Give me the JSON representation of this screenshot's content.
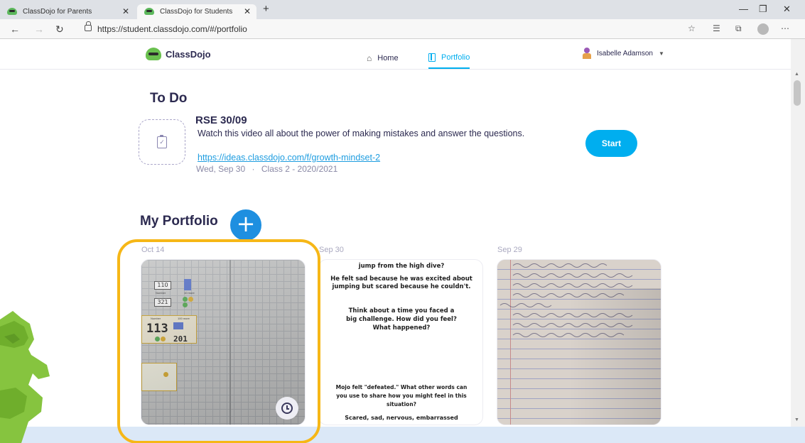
{
  "browser": {
    "tabs": [
      {
        "title": "ClassDojo for Parents",
        "active": false
      },
      {
        "title": "ClassDojo for Students",
        "active": true
      }
    ],
    "new_tab_symbol": "+",
    "url": "https://student.classdojo.com/#/portfolio",
    "nav_icons": [
      "back-arrow-icon",
      "forward-arrow-icon",
      "refresh-icon",
      "lock-icon"
    ],
    "toolbar_icons": [
      "favorite-star-icon",
      "favorites-list-icon",
      "collections-icon",
      "profile-icon",
      "more-icon"
    ],
    "window_controls": [
      "minimize-icon",
      "maximize-icon",
      "close-icon"
    ]
  },
  "header": {
    "brand": "ClassDojo",
    "nav": [
      {
        "label": "Home",
        "icon": "house-icon",
        "active": false
      },
      {
        "label": "Portfolio",
        "icon": "portfolio-icon",
        "active": true
      }
    ],
    "user_name": "Isabelle Adamson",
    "accent_color": "#00aeef"
  },
  "todo": {
    "heading": "To Do",
    "item": {
      "title": "RSE 30/09",
      "description": "Watch this video all about the power of making mistakes and answer the questions.",
      "link": "https://ideas.classdojo.com/f/growth-mindset-2",
      "date": "Wed, Sep 30",
      "separator": "·",
      "class_name": "Class 2 - 2020/2021",
      "start_label": "Start"
    }
  },
  "portfolio": {
    "heading": "My Portfolio",
    "add_symbol": "+",
    "posts": [
      {
        "date": "Oct 14",
        "highlight_color": "#f6b717",
        "worksheet": {
          "numbers": [
            "110",
            "321",
            "113",
            "201"
          ],
          "labels": [
            "Number",
            "10 more",
            "Number",
            "100 more"
          ]
        }
      },
      {
        "date": "Sep 30",
        "lines": [
          "jump from the high dive?",
          "He felt sad because he was excited about jumping but scared because he couldn't.",
          "Think about a time you faced a big challenge. How did you feel? What happened?",
          "Mojo felt \"defeated.\" What other words can you use to share how you might feel in this situation?",
          "Scared, sad, nervous, embarrassed"
        ]
      },
      {
        "date": "Sep 29"
      }
    ]
  }
}
